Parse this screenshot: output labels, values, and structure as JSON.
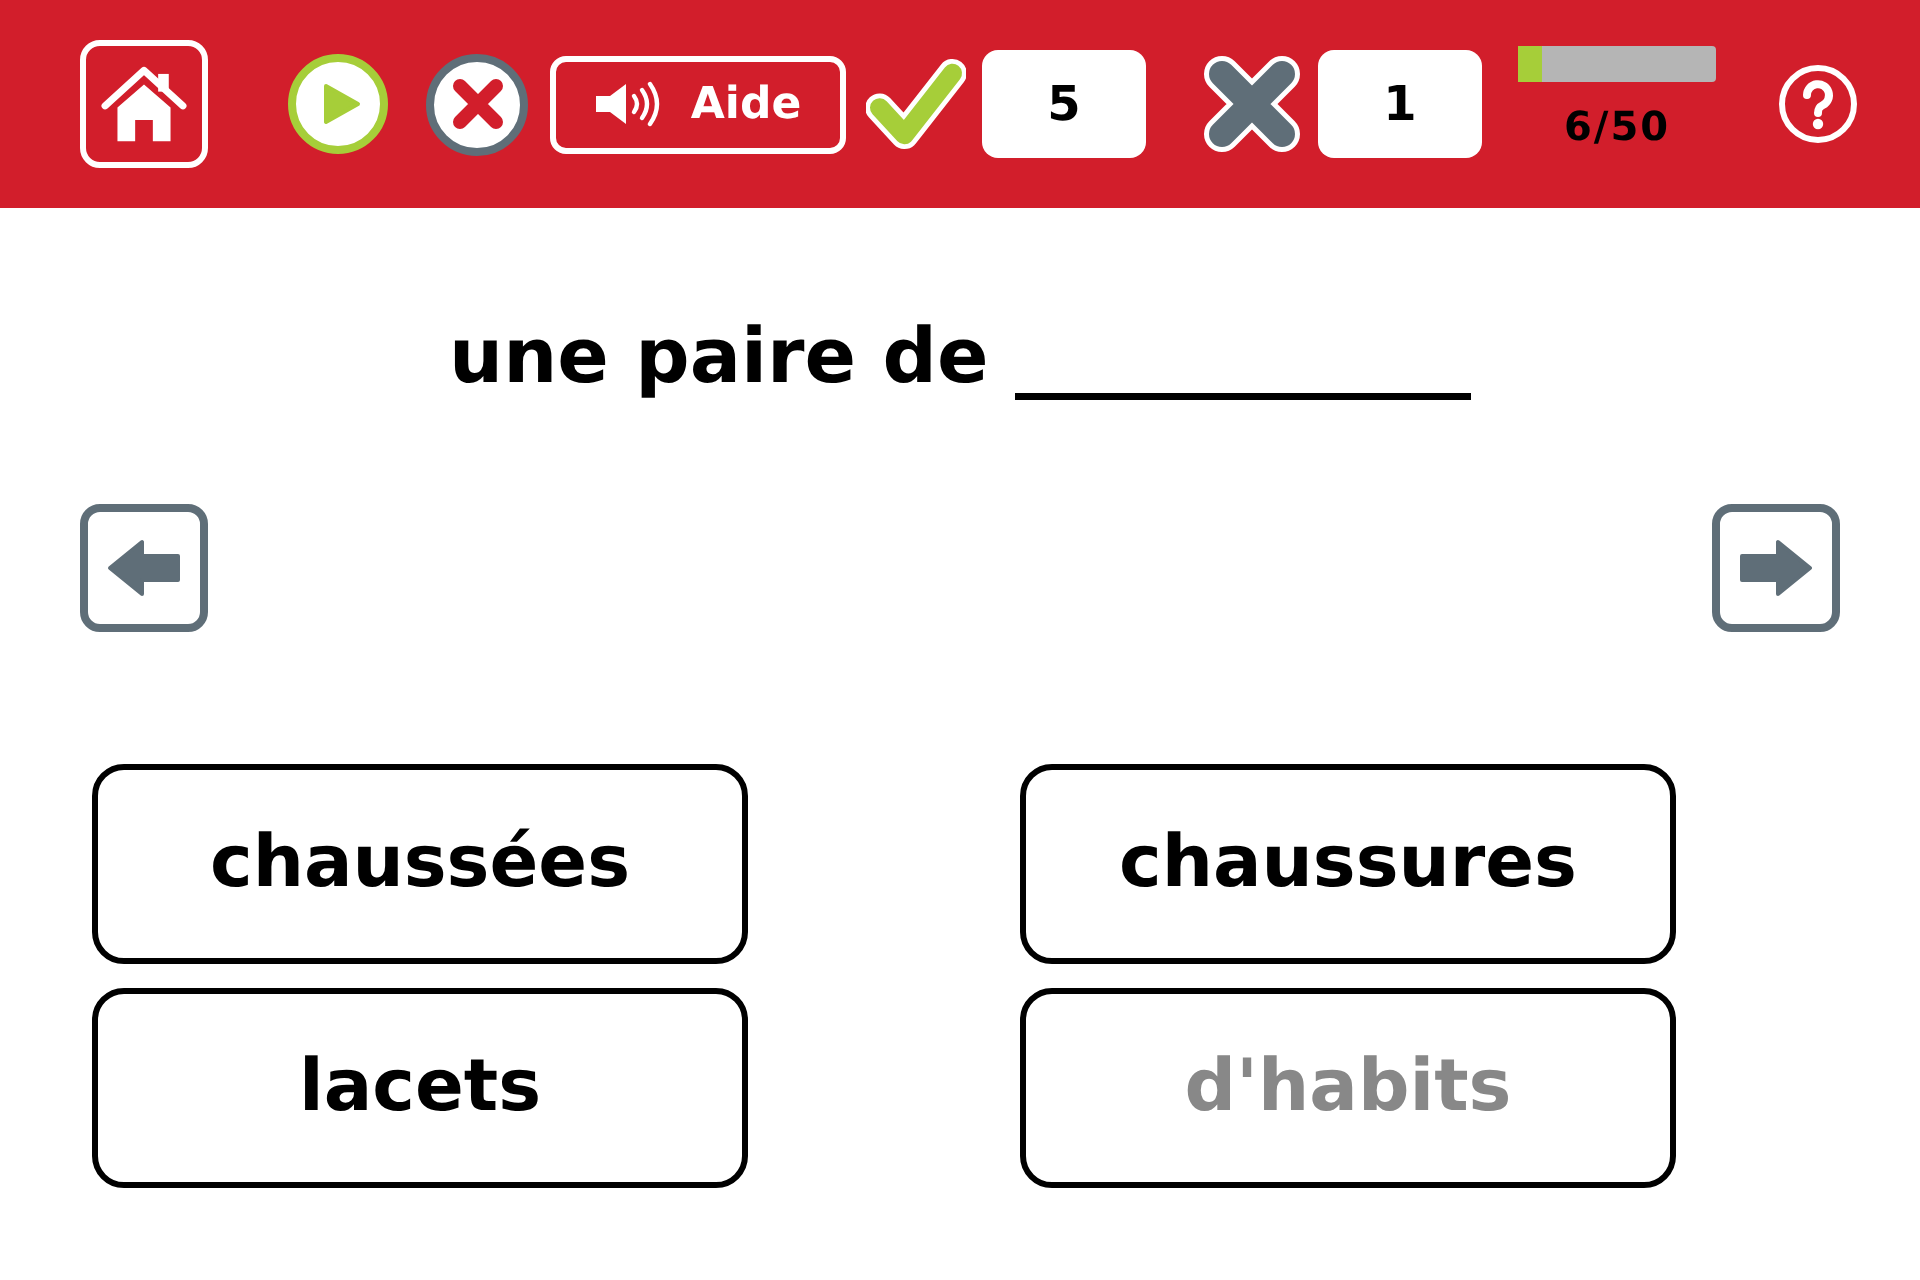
{
  "toolbar": {
    "aide_label": "Aide",
    "correct_count": "5",
    "wrong_count": "1",
    "progress": {
      "level": 0.12,
      "label": "6/50"
    }
  },
  "question": "une paire de ____________",
  "answers": [
    {
      "label": "chaussées",
      "disabled": false
    },
    {
      "label": "chaussures",
      "disabled": false
    },
    {
      "label": "lacets",
      "disabled": false
    },
    {
      "label": "d'habits",
      "disabled": true
    }
  ]
}
